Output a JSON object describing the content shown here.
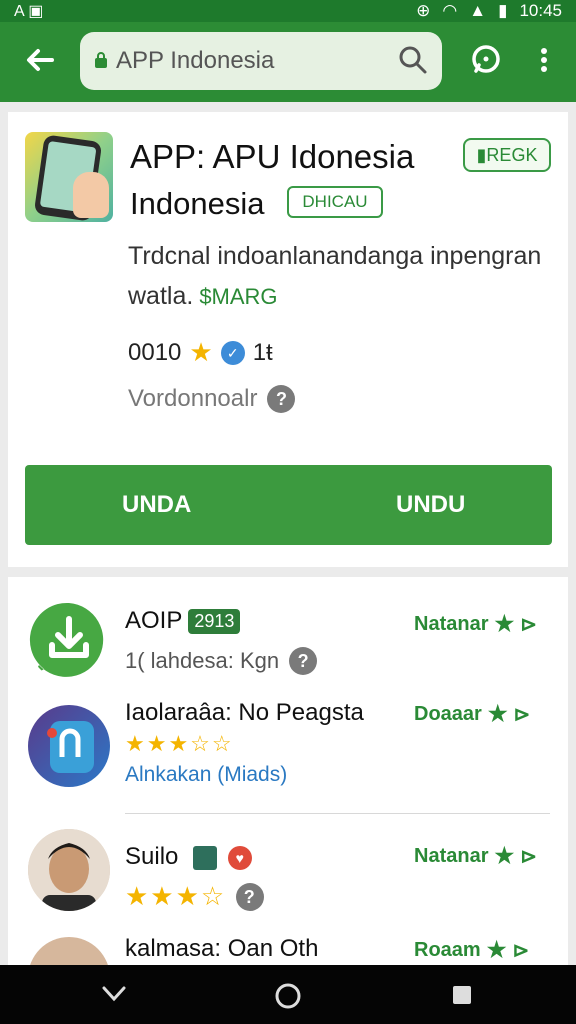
{
  "status_bar": {
    "left_icons": "A ▣",
    "time": "10:45"
  },
  "toolbar": {
    "search_text": "APP Indonesia",
    "colors": {
      "bar": "#2c8c35",
      "status": "#1e7a2c"
    }
  },
  "app": {
    "title_line1": "APP: APU Idonesia",
    "title_line2": "Indonesia",
    "badge_risk": "▮REGK",
    "badge_download": "DHICAU",
    "desc_line1": "Trdcnal indoanlanandanga inpengran",
    "desc_line2": "watla.",
    "price_tag": "$MARG",
    "rating_value": "0010",
    "rating_count": "1ŧ",
    "developer": "Vordonnoalr",
    "button_left": "UNDA",
    "button_right": "UNDU"
  },
  "list": [
    {
      "name": "AOIP",
      "chip": "2913",
      "subtitle": "1( lahdesa: Kgn",
      "action": "Natanar"
    },
    {
      "name": "Iaolaraâa: No Peagsta",
      "action": "Doaaar",
      "rating_stars": 3.5,
      "link": "Alnkakan (Miads)"
    },
    {
      "name": "Suilo",
      "action": "Natanar",
      "rating_stars": 3.5
    },
    {
      "name": "kalmasa: Oan Oth",
      "action": "Roaam"
    }
  ]
}
